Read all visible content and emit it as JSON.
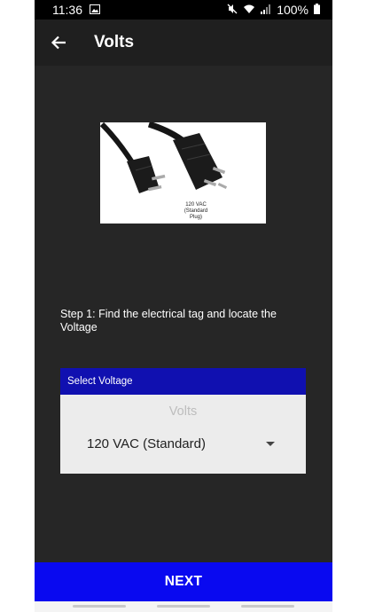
{
  "status": {
    "time": "11:36",
    "battery": "100%",
    "icons": [
      "image-icon",
      "mute-icon",
      "wifi-icon",
      "signal-icon",
      "battery-icon"
    ]
  },
  "appbar": {
    "title": "Volts",
    "back_icon": "arrow-back-icon"
  },
  "photo": {
    "caption_line1": "120 VAC",
    "caption_line2": "(Standard Plug)"
  },
  "step_text": "Step 1: Find the electrical tag and locate the Voltage",
  "select": {
    "header": "Select Voltage",
    "label": "Volts",
    "value": "120 VAC (Standard)"
  },
  "next_label": "NEXT",
  "colors": {
    "background": "#262626",
    "select_header": "#1010b0",
    "next_button": "#0909f0"
  }
}
